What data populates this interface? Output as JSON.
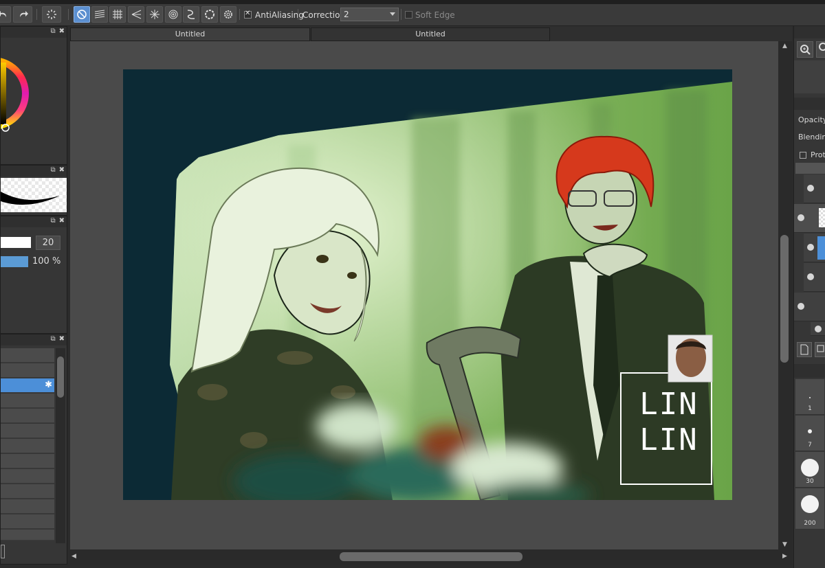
{
  "toolbar": {
    "antialiasing_label": "AntiAliasing",
    "antialiasing_checked": true,
    "correction_label": "Correction",
    "correction_value": "2",
    "soft_edge_label": "Soft Edge",
    "soft_edge_checked": false
  },
  "tabs": [
    "Untitled",
    "Untitled"
  ],
  "brush_size": {
    "size_value": "20",
    "opacity_value": "100 %",
    "opacity_fraction": 1.0
  },
  "right_panel": {
    "opacity_label": "Opacity",
    "blending_label": "Blending",
    "protect_label": "Prote",
    "brush_sizes": [
      "1",
      "7",
      "30",
      "200"
    ]
  },
  "artwork": {
    "watermark_line1": "LIN",
    "watermark_line2": "LIN"
  },
  "colors": {
    "accent": "#5b8fd0",
    "selection": "#4c8fd8",
    "canvas_bg": "#0c2a35"
  }
}
